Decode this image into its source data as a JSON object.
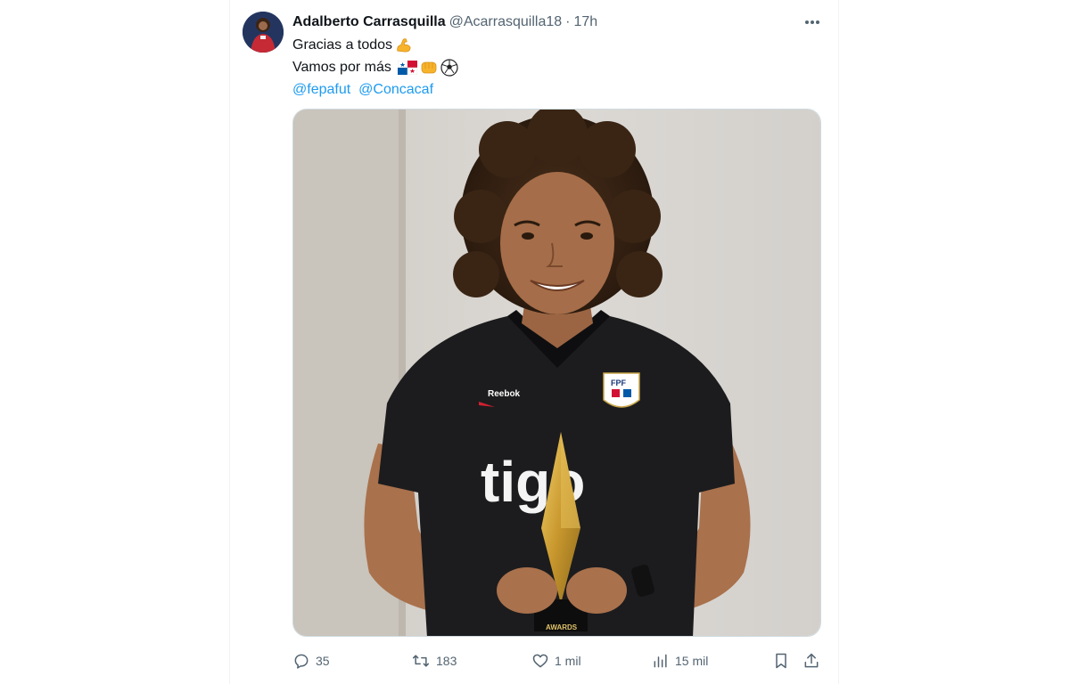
{
  "tweet": {
    "author_name": "Adalberto Carrasquilla",
    "author_handle": "@Acarrasquilla18",
    "separator": "·",
    "time": "17h",
    "lines": [
      "Gracias a todos",
      "Vamos por más"
    ],
    "mentions": [
      "@fepafut",
      "@Concacaf"
    ],
    "emojis": [
      "flexed-biceps-emoji",
      "panama-flag-emoji",
      "fist-bump-emoji",
      "soccer-ball-emoji"
    ]
  },
  "image": {
    "shirt_sponsor": "tigo",
    "shirt_brand": "Reebok",
    "crest_text": "FPF",
    "trophy_text": "AWARDS"
  },
  "actions": {
    "replies": "35",
    "reposts": "183",
    "likes": "1 mil",
    "views": "15 mil"
  },
  "colors": {
    "link": "#1d9bf0",
    "muted": "#536471",
    "text": "#0f1419"
  }
}
